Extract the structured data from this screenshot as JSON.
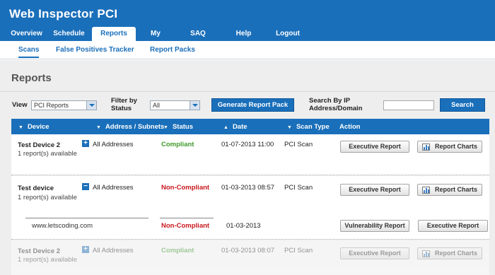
{
  "app": {
    "title": "Web Inspector PCI"
  },
  "nav": {
    "items": [
      {
        "label": "Overview"
      },
      {
        "label": "Schedule"
      },
      {
        "label": "Reports",
        "active": true
      },
      {
        "label": "My Account"
      },
      {
        "label": "SAQ"
      },
      {
        "label": "Help"
      },
      {
        "label": "Logout"
      }
    ]
  },
  "subnav": {
    "items": [
      {
        "label": "Scans",
        "active": true
      },
      {
        "label": "False Positives Tracker"
      },
      {
        "label": "Report Packs"
      }
    ]
  },
  "page": {
    "title": "Reports"
  },
  "filters": {
    "view_label": "View",
    "view_value": "PCI Reports",
    "status_label_1": "Filter by",
    "status_label_2": "Status",
    "status_value": "All",
    "generate_button": "Generate Report Pack",
    "search_label_1": "Search By IP",
    "search_label_2": "Address/Domain",
    "search_value": "",
    "search_button": "Search"
  },
  "table": {
    "columns": [
      "Device",
      "Address / Subnets",
      "Status",
      "Date",
      "Scan Type",
      "Action"
    ],
    "rows": [
      {
        "device": "Test Device 2",
        "reports": "1 report(s) available",
        "toggle": "+",
        "address": "All Addresses",
        "status": "Compliant",
        "date": "01-07-2013 11:00",
        "scan_type": "PCI Scan",
        "btn1": "Executive Report",
        "btn2": "Report Charts"
      },
      {
        "device": "Test device",
        "reports": "1 report(s) available",
        "toggle": "−",
        "address": "All Addresses",
        "status": "Non-Compliant",
        "date": "01-03-2013 08:57",
        "scan_type": "PCI Scan",
        "btn1": "Executive Report",
        "btn2": "Report Charts"
      },
      {
        "device": "Test Device 2",
        "reports": "1 report(s) available",
        "toggle": "+",
        "address": "All Addresses",
        "status": "Compliant",
        "date": "01-03-2013 08:07",
        "scan_type": "PCI Scan",
        "btn1": "Executive Report",
        "btn2": "Report Charts"
      }
    ],
    "subrow": {
      "address": "www.letscoding.com",
      "status": "Non-Compliant",
      "date": "01-03-2013",
      "btn1": "Vulnerability Report",
      "btn2": "Executive Report"
    }
  },
  "colors": {
    "brand": "#1a6fba",
    "compliant": "#3e9a2b",
    "non_compliant": "#c8161d"
  }
}
